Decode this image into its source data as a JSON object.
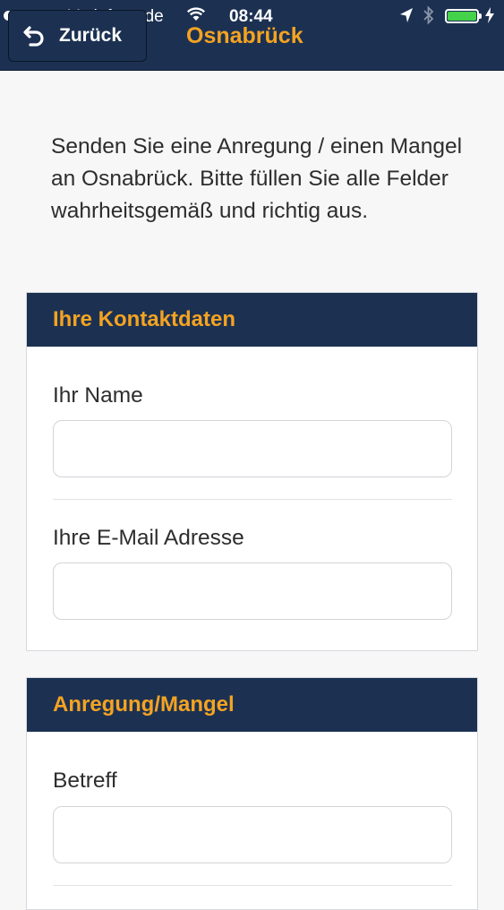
{
  "status_bar": {
    "carrier": "Vodafone.de",
    "time": "08:44"
  },
  "nav": {
    "back_label": "Zurück",
    "title": "Osnabrück"
  },
  "intro_text": "Senden Sie eine Anregung / einen Mangel an Osnabrück. Bitte füllen Sie alle Felder wahrheitsgemäß und richtig aus.",
  "contact_section": {
    "title": "Ihre Kontaktdaten",
    "name_label": "Ihr Name",
    "name_value": "",
    "email_label": "Ihre E-Mail Adresse",
    "email_value": ""
  },
  "issue_section": {
    "title": "Anregung/Mangel",
    "subject_label": "Betreff",
    "subject_value": ""
  },
  "colors": {
    "nav_background": "#1c3152",
    "accent": "#f4a321",
    "battery": "#44d24a"
  },
  "icons": {
    "back": "back-arrow-icon",
    "signal": "signal-dots-icon",
    "wifi": "wifi-icon",
    "location": "location-arrow-icon",
    "bluetooth": "bluetooth-icon",
    "battery": "battery-icon",
    "charging": "charging-bolt-icon"
  }
}
